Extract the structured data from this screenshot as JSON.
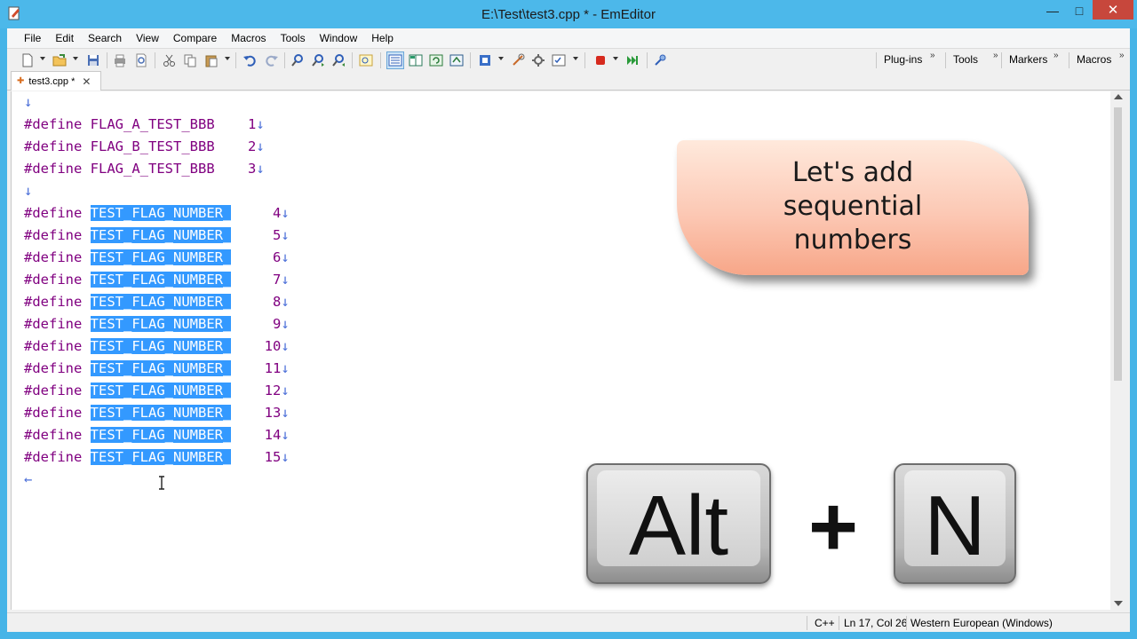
{
  "window": {
    "title": "E:\\Test\\test3.cpp * - EmEditor",
    "minimize": "—",
    "maximize": "□",
    "close": "✕"
  },
  "menu": [
    "File",
    "Edit",
    "Search",
    "View",
    "Compare",
    "Macros",
    "Tools",
    "Window",
    "Help"
  ],
  "toolbar": {
    "right_labels": [
      "Plug-ins",
      "Tools",
      "Markers",
      "Macros"
    ]
  },
  "tab": {
    "label": "test3.cpp *",
    "pin": "✚",
    "close": "✕"
  },
  "editor": {
    "newline_mark": "↓",
    "eof_mark": "←",
    "keyword": "#define",
    "defines_top": [
      {
        "name": "FLAG_A_TEST_BBB",
        "value": "1"
      },
      {
        "name": "FLAG_B_TEST_BBB",
        "value": "2"
      },
      {
        "name": "FLAG_A_TEST_BBB",
        "value": "3"
      }
    ],
    "selected_prefix": "TEST_FLAG_NUMBER_",
    "selected_values": [
      "4",
      "5",
      "6",
      "7",
      "8",
      "9",
      "10",
      "11",
      "12",
      "13",
      "14",
      "15"
    ]
  },
  "status": {
    "language": "C++",
    "position": "Ln 17, Col 26",
    "encoding": "Western European (Windows)"
  },
  "overlay": {
    "callout_lines": [
      "Let's add",
      "sequential",
      "numbers"
    ],
    "key1": "Alt",
    "plus": "+",
    "key2": "N"
  }
}
